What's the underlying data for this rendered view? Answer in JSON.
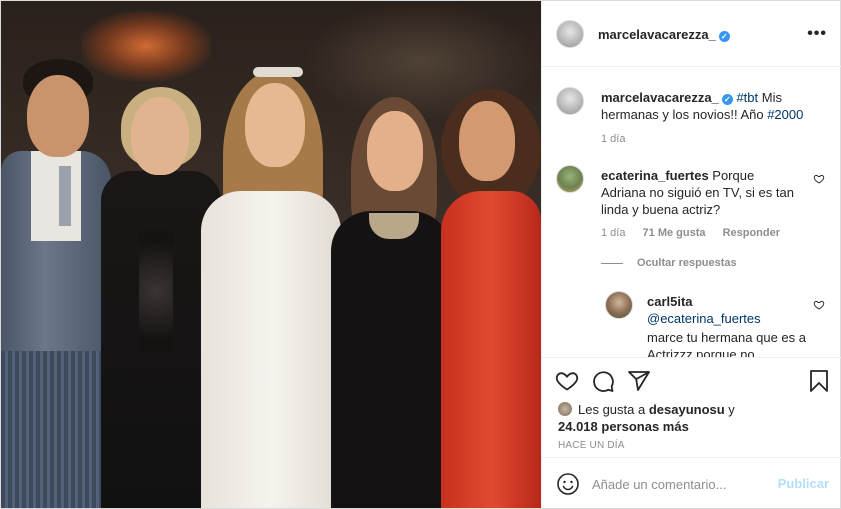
{
  "post": {
    "author": "marcelavacarezza_",
    "verified_mark": "✓",
    "more_label": "•••"
  },
  "caption": {
    "username": "marcelavacarezza_",
    "hashtag": "#tbt",
    "text_1": " Mis hermanas y los novios!! Año ",
    "year_tag": "#2000",
    "time": "1 día"
  },
  "comments": [
    {
      "username": "ecaterina_fuertes",
      "text": " Porque Adriana no siguió en TV, si es tan linda y buena actriz?",
      "time": "1 día",
      "likes": "71 Me gusta",
      "reply_label": "Responder"
    }
  ],
  "replies_toggle": "Ocultar respuestas",
  "reply": {
    "username": "carl5ita",
    "mention": "@ecaterina_fuertes",
    "text": "marce tu hermana que es a Actrizzz porque no"
  },
  "likes": {
    "prefix": "Les gusta a ",
    "user": "desayunosu",
    "middle": " y",
    "count": "24.018 personas más"
  },
  "posted_ago": "HACE UN DÍA",
  "composer": {
    "placeholder": "Añade un comentario...",
    "publish_label": "Publicar"
  },
  "icons": {
    "like": "heart-icon",
    "comment": "comment-icon",
    "share": "share-icon",
    "save": "bookmark-icon",
    "emoji": "emoji-icon",
    "more": "more-icon"
  },
  "colors": {
    "link": "#00376b",
    "publish_disabled": "#b2dffc",
    "verified": "#3897f0"
  }
}
